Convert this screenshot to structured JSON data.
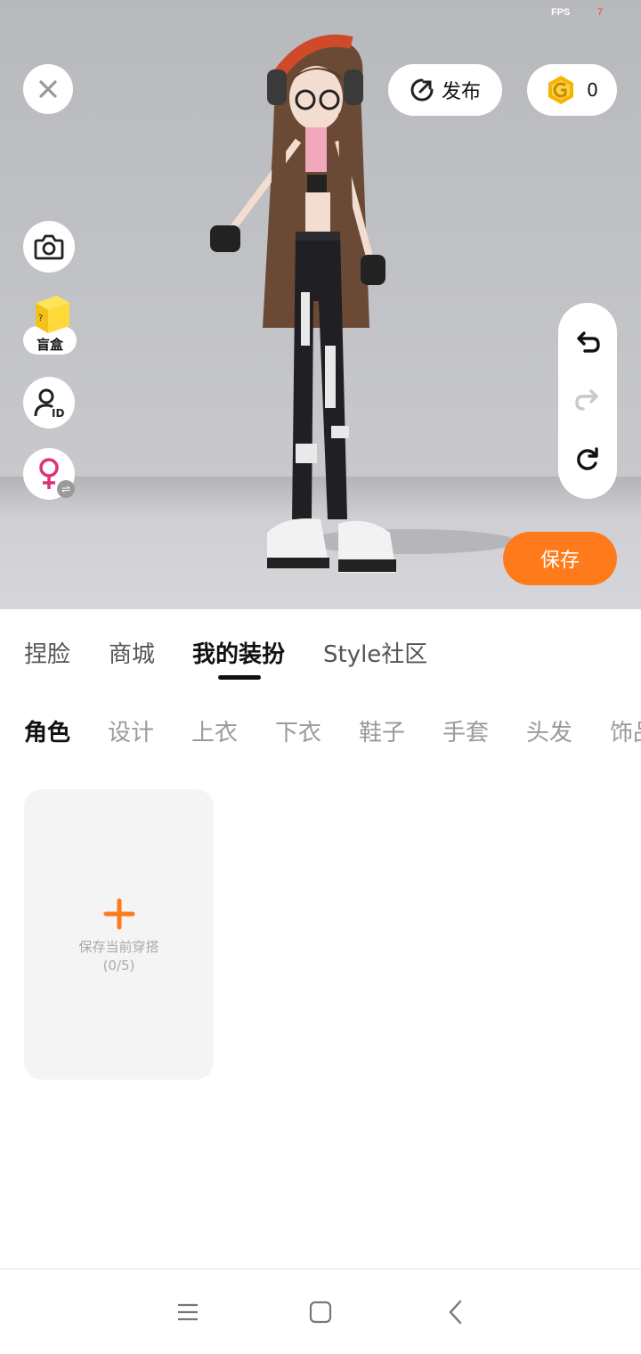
{
  "status": {
    "fps_label": "FPS",
    "fps_value": "7"
  },
  "toolbar": {
    "publish_label": "发布",
    "coin_count": "0",
    "blindbox_label": "盲盒",
    "blindbox_cube_text": "?",
    "save_label": "保存",
    "gender_swap_glyph": "⇌",
    "id_badge_text": "ID"
  },
  "main_tabs": [
    {
      "label": "捏脸"
    },
    {
      "label": "商城"
    },
    {
      "label": "我的装扮"
    },
    {
      "label": "Style社区"
    }
  ],
  "sub_tabs": [
    {
      "label": "角色"
    },
    {
      "label": "设计"
    },
    {
      "label": "上衣"
    },
    {
      "label": "下衣"
    },
    {
      "label": "鞋子"
    },
    {
      "label": "手套"
    },
    {
      "label": "头发"
    },
    {
      "label": "饰品"
    }
  ],
  "outfit_card": {
    "label": "保存当前穿搭",
    "count": "(0/5)"
  },
  "colors": {
    "accent": "#ff7a1a",
    "coin": "#f5b400",
    "gender": "#e0307a"
  },
  "icons": [
    "close-icon",
    "publish-icon",
    "coin-icon",
    "camera-icon",
    "blindbox-icon",
    "user-id-icon",
    "female-icon",
    "undo-icon",
    "redo-icon",
    "reset-icon",
    "plus-icon",
    "menu-icon",
    "home-icon",
    "back-icon"
  ]
}
